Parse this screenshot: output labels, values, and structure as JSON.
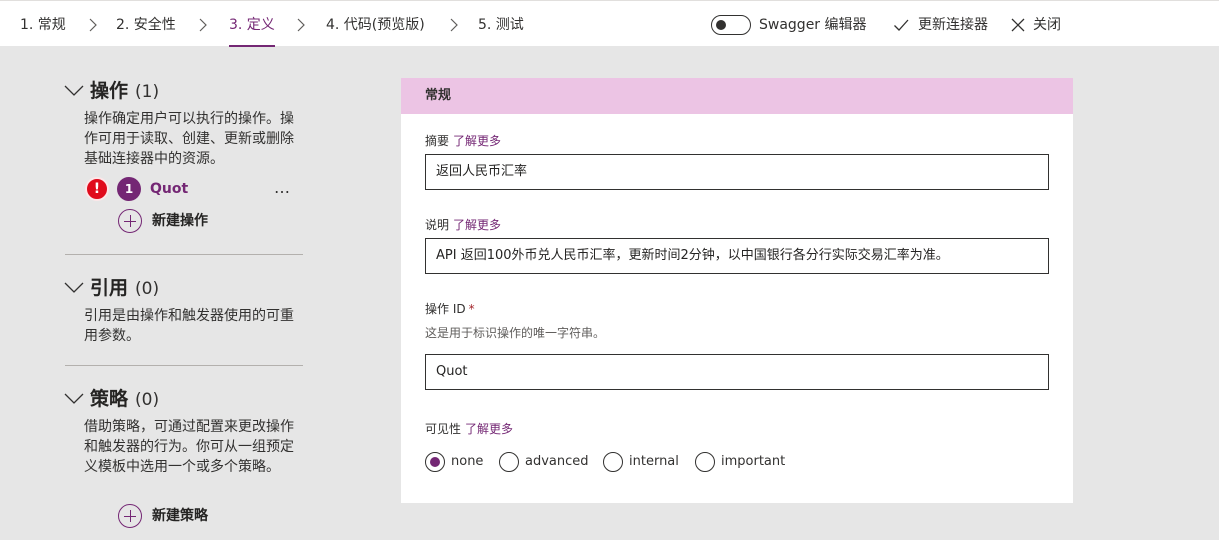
{
  "steps": [
    {
      "label": "1. 常规"
    },
    {
      "label": "2. 安全性"
    },
    {
      "label": "3. 定义"
    },
    {
      "label": "4. 代码(预览版)"
    },
    {
      "label": "5. 测试"
    }
  ],
  "toolbar": {
    "swagger_label": "Swagger 编辑器",
    "swagger_toggle_on": false,
    "update_label": "更新连接器",
    "close_label": "关闭"
  },
  "left": {
    "actions": {
      "title": "操作",
      "count": "(1)",
      "description": "操作确定用户可以执行的操作。操作可用于读取、创建、更新或删除基础连接器中的资源。",
      "items": [
        {
          "index": "1",
          "name": "Quot",
          "error_glyph": "!",
          "more": "…"
        }
      ],
      "add_label": "新建操作"
    },
    "references": {
      "title": "引用",
      "count": "(0)",
      "description": "引用是由操作和触发器使用的可重用参数。"
    },
    "policies": {
      "title": "策略",
      "count": "(0)",
      "description": "借助策略，可通过配置来更改操作和触发器的行为。你可从一组预定义模板中选用一个或多个策略。",
      "add_label": "新建策略"
    }
  },
  "general": {
    "header": "常规",
    "summary": {
      "label": "摘要",
      "link": "了解更多",
      "value": "返回人民币汇率"
    },
    "description": {
      "label": "说明",
      "link": "了解更多",
      "value": "API 返回100外币兑人民币汇率，更新时间2分钟，以中国银行各分行实际交易汇率为准。"
    },
    "operation_id": {
      "label": "操作 ID",
      "required": "*",
      "hint": "这是用于标识操作的唯一字符串。",
      "value": "Quot"
    },
    "visibility": {
      "label": "可见性",
      "link": "了解更多",
      "selected": "none",
      "options": [
        "none",
        "advanced",
        "internal",
        "important"
      ]
    }
  },
  "colors": {
    "accent": "#742774",
    "header_bg": "#ecc4e4",
    "error": "#e00b1c",
    "page_bg": "#e6e6e6"
  }
}
